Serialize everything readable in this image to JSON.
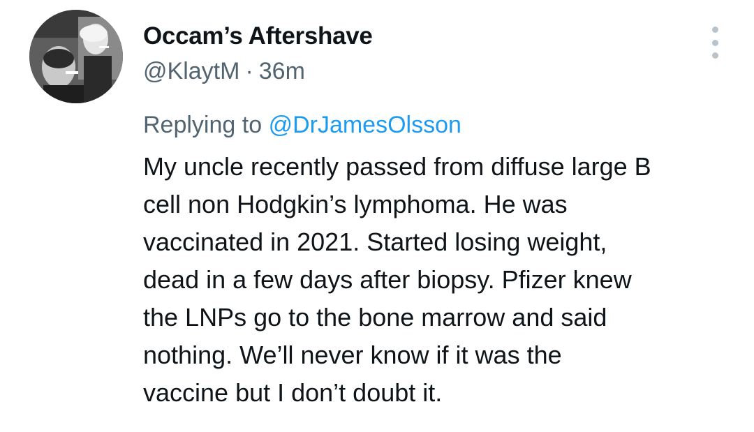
{
  "author": {
    "display_name": "Occam’s Aftershave",
    "handle": "@KlaytM",
    "separator": "·",
    "timestamp": "36m",
    "avatar": "profile-photo"
  },
  "reply": {
    "prefix": "Replying to",
    "mention": "@DrJamesOlsson"
  },
  "tweet": {
    "lines": [
      "My uncle recently passed from diffuse large B",
      "cell non Hodgkin’s lymphoma. He was",
      "vaccinated in 2021. Started losing weight,",
      "dead in a few days after biopsy. Pfizer knew",
      "the LNPs go to the bone marrow and said",
      "nothing. We’ll never know if it was the",
      "vaccine but I don’t doubt it."
    ]
  },
  "icons": {
    "more": "more-vertical-icon"
  },
  "colors": {
    "text": "#0f1419",
    "secondary": "#536471",
    "link": "#1d9bf0",
    "icon": "#b9c3cb"
  }
}
